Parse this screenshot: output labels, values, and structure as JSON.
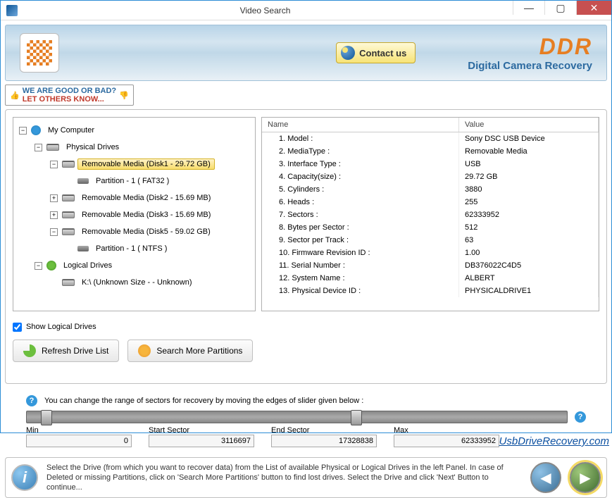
{
  "window": {
    "title": "Video Search"
  },
  "banner": {
    "brand": "DDR",
    "subtitle": "Digital Camera Recovery",
    "contact_label": "Contact us"
  },
  "feedback": {
    "line1": "WE ARE GOOD OR BAD?",
    "line2": "LET OTHERS KNOW..."
  },
  "tree": {
    "root": "My Computer",
    "physical_header": "Physical Drives",
    "items": [
      {
        "label": "Removable Media (Disk1 - 29.72 GB)",
        "selected": true,
        "expanded": true,
        "partitions": [
          "Partition - 1 ( FAT32 )"
        ]
      },
      {
        "label": "Removable Media (Disk2 - 15.69 MB)",
        "selected": false,
        "expanded": false,
        "partitions": []
      },
      {
        "label": "Removable Media (Disk3 - 15.69 MB)",
        "selected": false,
        "expanded": false,
        "partitions": []
      },
      {
        "label": "Removable Media (Disk5 - 59.02 GB)",
        "selected": false,
        "expanded": true,
        "partitions": [
          "Partition - 1 ( NTFS )"
        ]
      }
    ],
    "logical_header": "Logical Drives",
    "logical_items": [
      {
        "label": "K:\\ (Unknown Size  -  - Unknown)"
      }
    ]
  },
  "details": {
    "col_name": "Name",
    "col_value": "Value",
    "rows": [
      {
        "name": "1. Model :",
        "value": "Sony DSC USB Device"
      },
      {
        "name": "2. MediaType :",
        "value": "Removable Media"
      },
      {
        "name": "3. Interface Type :",
        "value": "USB"
      },
      {
        "name": "4. Capacity(size) :",
        "value": "29.72 GB"
      },
      {
        "name": "5. Cylinders :",
        "value": "3880"
      },
      {
        "name": "6. Heads :",
        "value": "255"
      },
      {
        "name": "7. Sectors :",
        "value": "62333952"
      },
      {
        "name": "8. Bytes per Sector :",
        "value": "512"
      },
      {
        "name": "9. Sector per Track :",
        "value": "63"
      },
      {
        "name": "10. Firmware Revision ID :",
        "value": "1.00"
      },
      {
        "name": "11. Serial Number :",
        "value": "DB376022C4D5"
      },
      {
        "name": "12. System Name :",
        "value": "ALBERT"
      },
      {
        "name": "13. Physical Device ID :",
        "value": "PHYSICALDRIVE1"
      }
    ]
  },
  "controls": {
    "show_logical_label": "Show Logical Drives",
    "show_logical_checked": true,
    "refresh_label": "Refresh Drive List",
    "search_more_label": "Search More Partitions"
  },
  "sectors": {
    "hint": "You can change the range of sectors for recovery by moving the edges of slider given below :",
    "min_label": "Min",
    "min_value": "0",
    "start_label": "Start Sector",
    "start_value": "3116697",
    "end_label": "End Sector",
    "end_value": "17328838",
    "max_label": "Max",
    "max_value": "62333952"
  },
  "info_text": "Select the Drive (from which you want to recover data) from the List of available Physical or Logical Drives in the left Panel. In case of Deleted or missing Partitions, click on 'Search More Partitions' button to find lost drives. Select the Drive and click 'Next' Button to continue...",
  "footer_link": "UsbDriveRecovery.com"
}
